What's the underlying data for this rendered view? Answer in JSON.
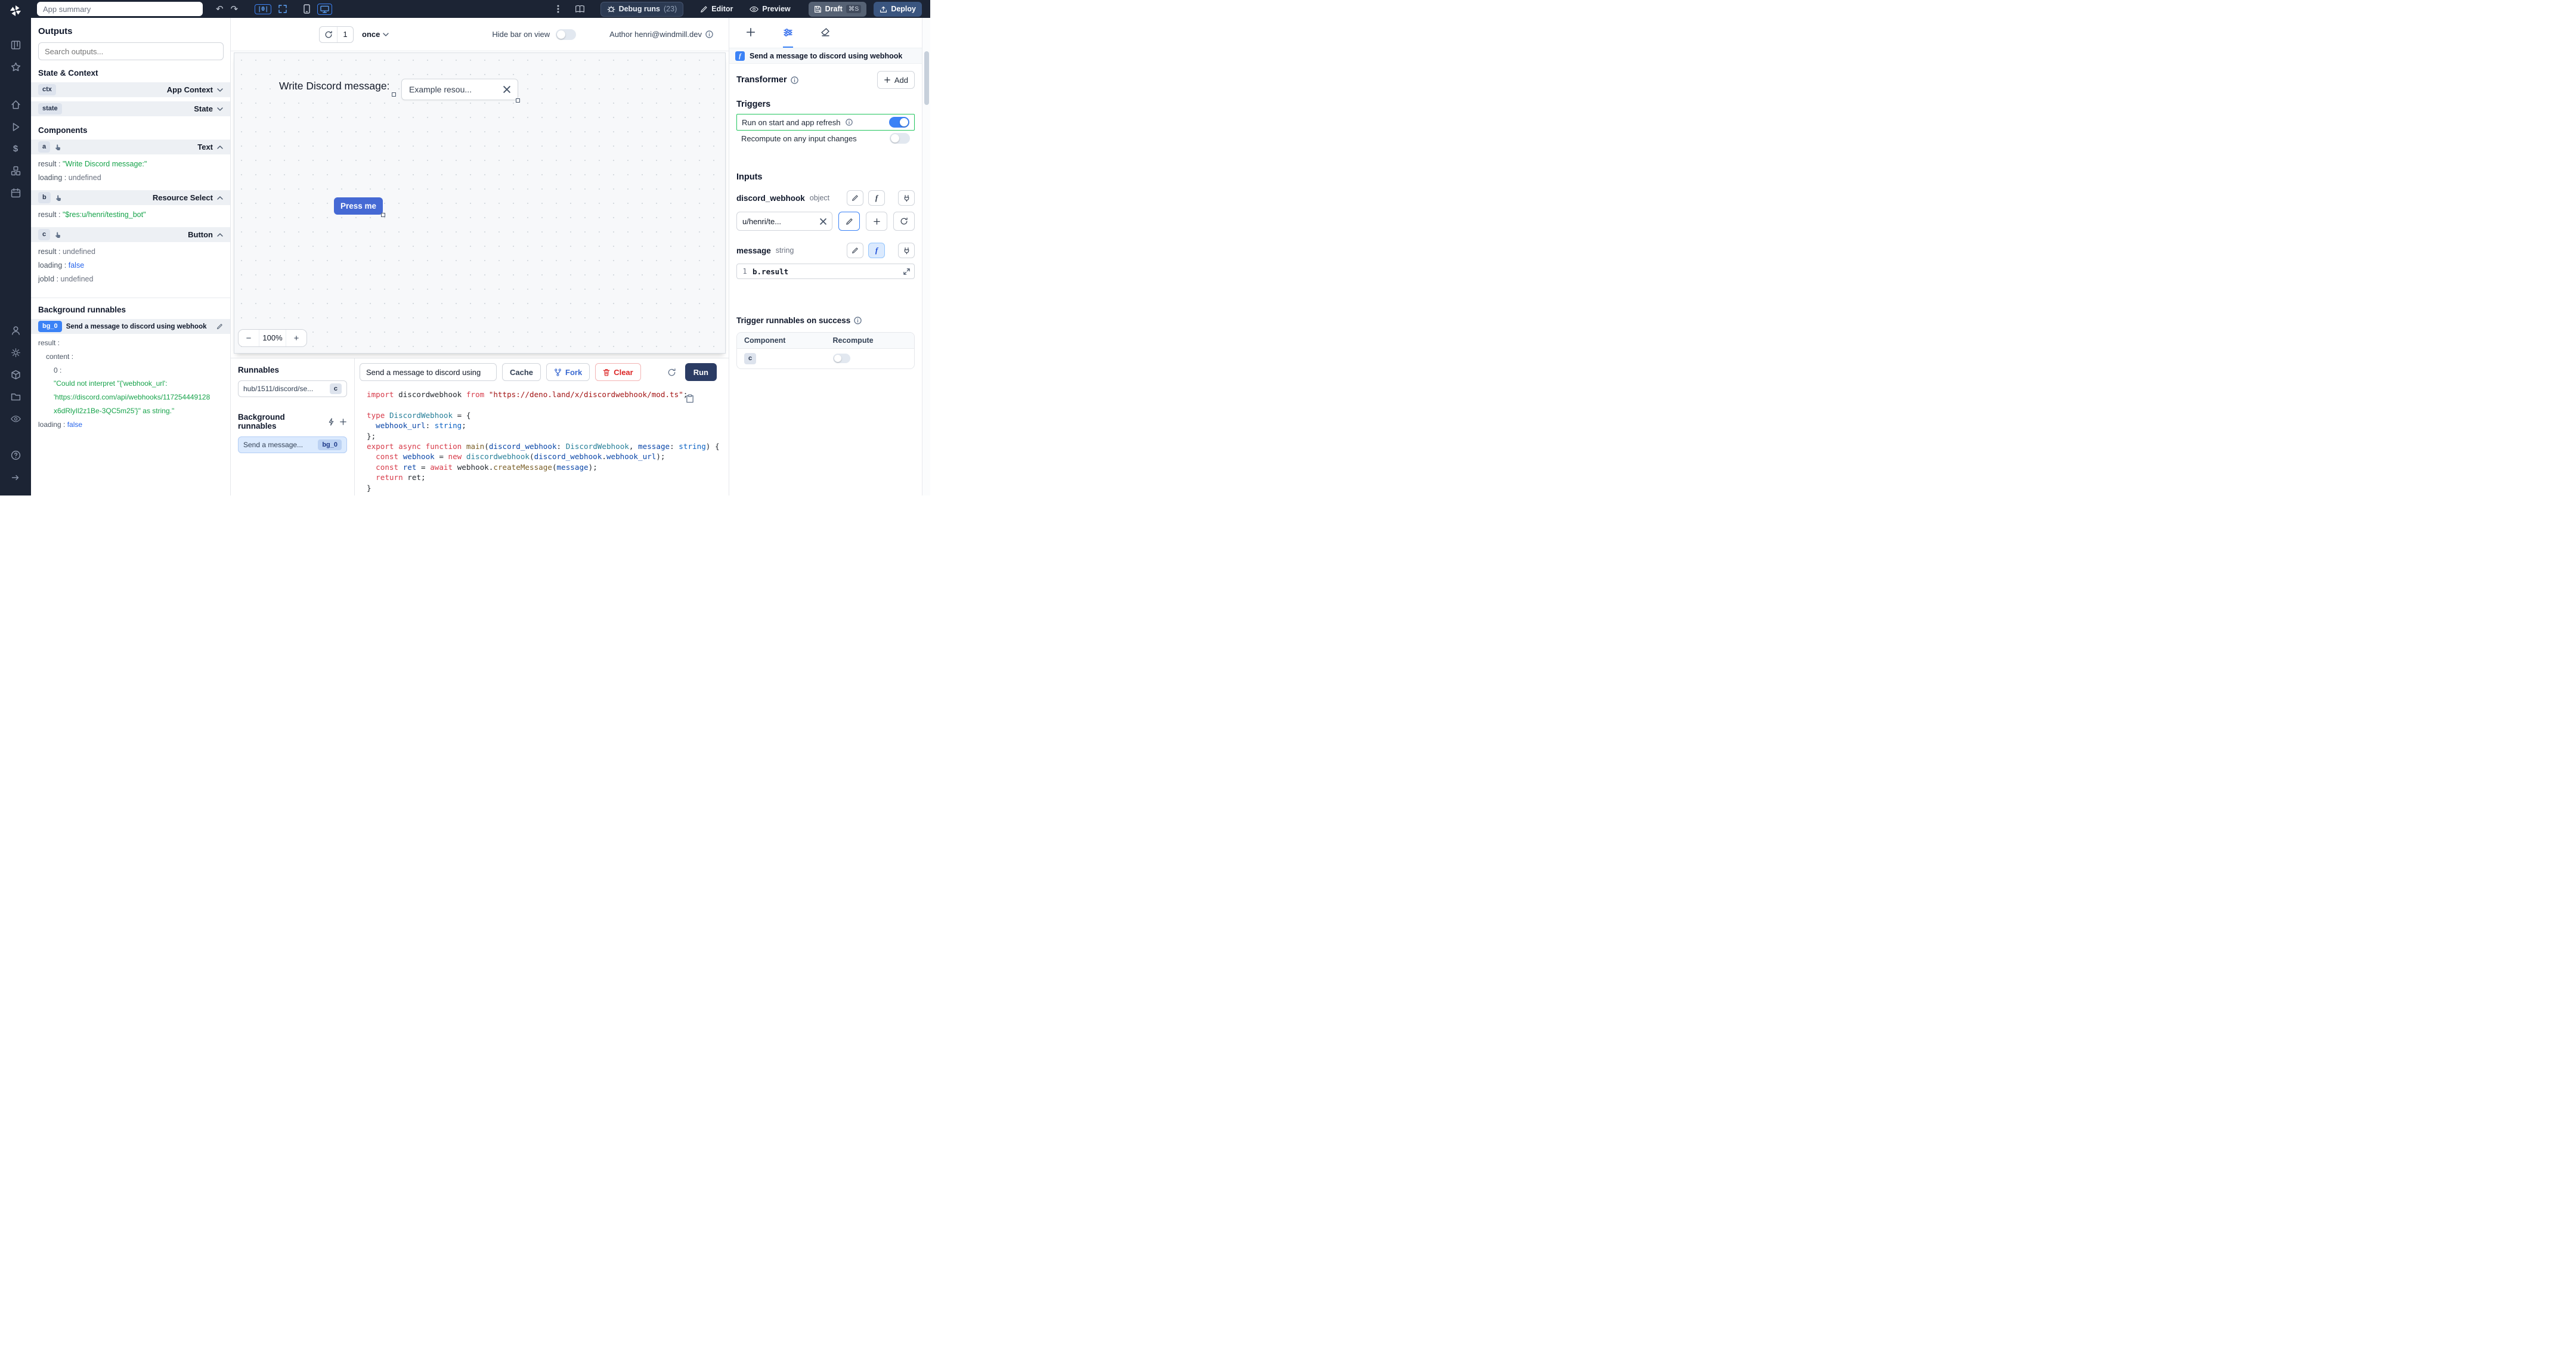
{
  "punct": {
    "sep": " : ",
    "colon": " :"
  },
  "glyphs": {
    "function": "f",
    "align": "|0|"
  },
  "topbar": {
    "app_summary": "App summary",
    "debug_runs": "Debug runs",
    "debug_count": "(23)",
    "editor": "Editor",
    "preview": "Preview",
    "draft": "Draft",
    "draft_shortcut": "⌘S",
    "deploy": "Deploy"
  },
  "canvas_bar": {
    "refresh_count": "1",
    "schedule": "once",
    "hide_bar": "Hide bar on view",
    "author": "Author henri@windmill.dev"
  },
  "canvas": {
    "text_value": "Write Discord message:",
    "select_value": "Example resou...",
    "button_label": "Press me",
    "zoom_out": "−",
    "zoom_level": "100%",
    "zoom_in": "+"
  },
  "outputs": {
    "title": "Outputs",
    "search_placeholder": "Search outputs...",
    "state_context": "State & Context",
    "ctx": {
      "badge": "ctx",
      "label": "App Context"
    },
    "state": {
      "badge": "state",
      "label": "State"
    },
    "components_title": "Components",
    "comp_a": {
      "badge": "a",
      "type": "Text",
      "rows": [
        {
          "key": "result",
          "value": "\"Write Discord message:\""
        },
        {
          "key": "loading",
          "value": "undefined"
        }
      ]
    },
    "comp_b": {
      "badge": "b",
      "type": "Resource Select",
      "rows": [
        {
          "key": "result",
          "value": "\"$res:u/henri/testing_bot\""
        }
      ]
    },
    "comp_c": {
      "badge": "c",
      "type": "Button",
      "rows": [
        {
          "key": "result",
          "value": "undefined"
        },
        {
          "key": "loading",
          "value": "false"
        },
        {
          "key": "jobId",
          "value": "undefined"
        }
      ]
    },
    "background_title": "Background runnables",
    "bg0": {
      "badge": "bg_0",
      "title": "Send a message to discord using webhook",
      "l1": "result",
      "l2": "content",
      "l3": "0",
      "g1": "\"Could not interpret \"{'webhook_url':",
      "g2": "'https://discord.com/api/webhooks/117254449128",
      "g3": "x6dRlyIl2z1Be-3QC5m25'}\" as string.\"",
      "l4_key": "loading",
      "l4_val": "false"
    }
  },
  "runnables": {
    "title": "Runnables",
    "hub_label": "hub/1511/discord/se...",
    "hub_badge": "c",
    "bg_title": "Background runnables",
    "bg_label": "Send a message...",
    "bg_badge": "bg_0"
  },
  "editor": {
    "title": "Send a message to discord using",
    "cache": "Cache",
    "fork": "Fork",
    "clear": "Clear",
    "run": "Run",
    "code_lines": [
      [
        [
          "kw",
          "import"
        ],
        [
          "pl",
          " discordwebhook "
        ],
        [
          "kw",
          "from"
        ],
        [
          "pl",
          " "
        ],
        [
          "str",
          "\"https://deno.land/x/discordwebhook/mod.ts\""
        ],
        [
          "pl",
          ";"
        ]
      ],
      [],
      [
        [
          "kw",
          "type"
        ],
        [
          "pl",
          " "
        ],
        [
          "ty",
          "DiscordWebhook"
        ],
        [
          "pl",
          " = {"
        ]
      ],
      [
        [
          "pl",
          "  "
        ],
        [
          "vr",
          "webhook_url"
        ],
        [
          "pl",
          ": "
        ],
        [
          "ty2",
          "string"
        ],
        [
          "pl",
          ";"
        ]
      ],
      [
        [
          "pl",
          "};"
        ]
      ],
      [
        [
          "kw",
          "export"
        ],
        [
          "pl",
          " "
        ],
        [
          "kw",
          "async"
        ],
        [
          "pl",
          " "
        ],
        [
          "kw",
          "function"
        ],
        [
          "pl",
          " "
        ],
        [
          "fn",
          "main"
        ],
        [
          "pl",
          "("
        ],
        [
          "vr",
          "discord_webhook"
        ],
        [
          "pl",
          ": "
        ],
        [
          "ty",
          "DiscordWebhook"
        ],
        [
          "pl",
          ", "
        ],
        [
          "vr",
          "message"
        ],
        [
          "pl",
          ": "
        ],
        [
          "ty2",
          "string"
        ],
        [
          "pl",
          ") {"
        ]
      ],
      [
        [
          "pl",
          "  "
        ],
        [
          "kw",
          "const"
        ],
        [
          "pl",
          " "
        ],
        [
          "vr",
          "webhook"
        ],
        [
          "pl",
          " = "
        ],
        [
          "kw",
          "new"
        ],
        [
          "pl",
          " "
        ],
        [
          "ty",
          "discordwebhook"
        ],
        [
          "pl",
          "("
        ],
        [
          "vr",
          "discord_webhook"
        ],
        [
          "pl",
          "."
        ],
        [
          "vr",
          "webhook_url"
        ],
        [
          "pl",
          ");"
        ]
      ],
      [
        [
          "pl",
          "  "
        ],
        [
          "kw",
          "const"
        ],
        [
          "pl",
          " "
        ],
        [
          "vr",
          "ret"
        ],
        [
          "pl",
          " = "
        ],
        [
          "kw",
          "await"
        ],
        [
          "pl",
          " webhook."
        ],
        [
          "fn",
          "createMessage"
        ],
        [
          "pl",
          "("
        ],
        [
          "vr",
          "message"
        ],
        [
          "pl",
          ");"
        ]
      ],
      [
        [
          "pl",
          "  "
        ],
        [
          "kw",
          "return"
        ],
        [
          "pl",
          " ret;"
        ]
      ],
      [
        [
          "pl",
          "}"
        ]
      ]
    ]
  },
  "settings": {
    "header": "Send a message to discord using webhook",
    "transformer": "Transformer",
    "add": "Add",
    "triggers": "Triggers",
    "run_on_start": "Run on start and app refresh",
    "recompute": "Recompute on any input changes",
    "inputs": "Inputs",
    "field1_name": "discord_webhook",
    "field1_type": "object",
    "field1_value": "u/henri/te...",
    "field2_name": "message",
    "field2_type": "string",
    "expr_line": "1",
    "expr": "b.result",
    "success_title": "Trigger runnables on success",
    "col_component": "Component",
    "col_recompute": "Recompute",
    "row_badge": "c"
  }
}
